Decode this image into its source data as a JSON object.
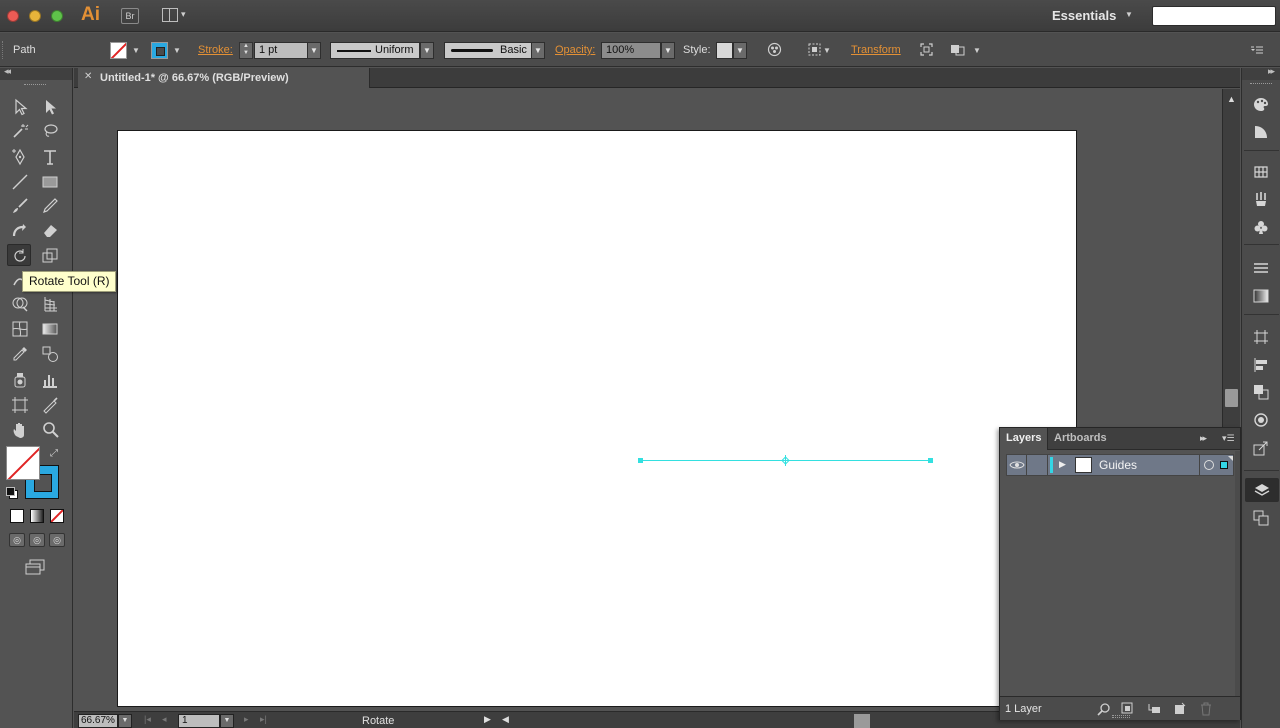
{
  "app": {
    "logo": "Ai",
    "bridge": "Br",
    "workspace": "Essentials",
    "search_placeholder": ""
  },
  "control": {
    "selection_label": "Path",
    "stroke_label": "Stroke:",
    "stroke_weight": "1 pt",
    "variable_width_profile": "Uniform",
    "brush_definition": "Basic",
    "opacity_label": "Opacity:",
    "opacity_value": "100%",
    "style_label": "Style:",
    "transform_label": "Transform",
    "fill_color": "none",
    "stroke_color": "#2aa8e0"
  },
  "document": {
    "tab_title": "Untitled-1* @ 66.67% (RGB/Preview)",
    "guide_color": "#33e0e0",
    "artboard_color": "#ffffff"
  },
  "tooltip": {
    "text": "Rotate Tool (R)"
  },
  "status": {
    "zoom": "66.67%",
    "artboard_number": "1",
    "current_tool": "Rotate"
  },
  "layers_panel": {
    "tabs": [
      "Layers",
      "Artboards"
    ],
    "active_tab": "Layers",
    "layers": [
      {
        "name": "Guides",
        "color": "#33d6e6",
        "visible": true
      }
    ],
    "count_label": "1 Layer"
  },
  "colors": {
    "accent_link": "#e39035",
    "stroke_blue": "#2aa8e0",
    "none_red": "#e02424"
  }
}
